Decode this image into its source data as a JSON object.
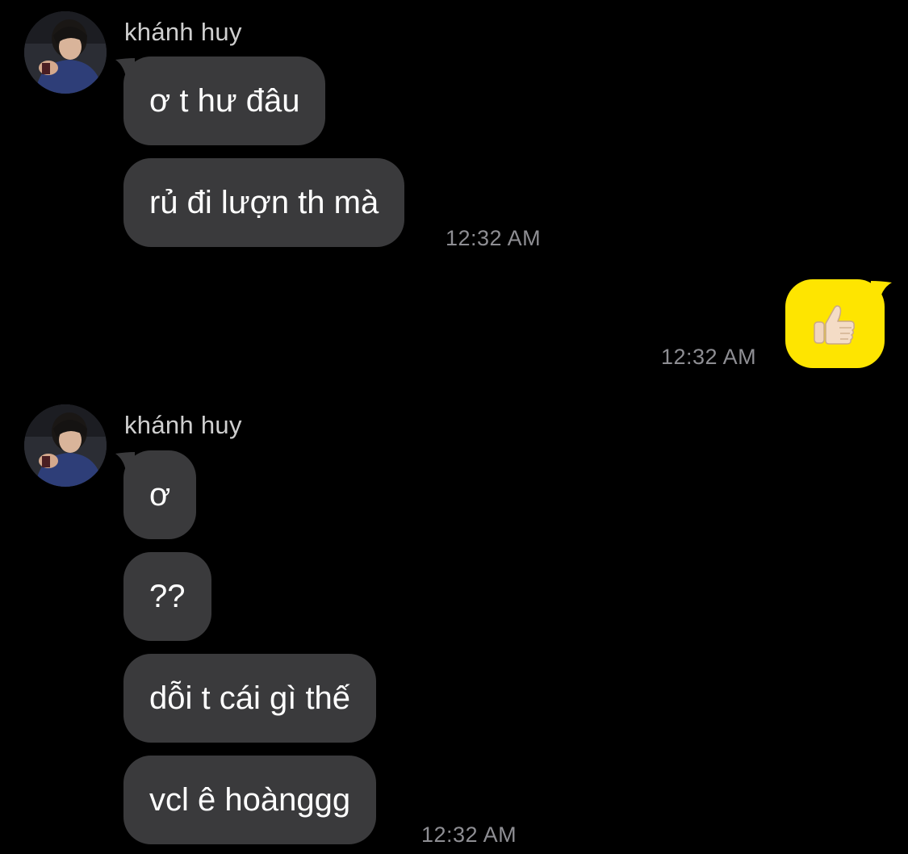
{
  "conversation": {
    "group1": {
      "sender_name": "khánh huy",
      "messages": [
        "ơ t hư đâu",
        "rủ đi lượn th mà"
      ],
      "timestamp": "12:32 AM"
    },
    "outgoing": {
      "reaction": "thumbs-up",
      "timestamp": "12:32 AM"
    },
    "group2": {
      "sender_name": "khánh huy",
      "messages": [
        "ơ",
        "??",
        "dỗi t cái gì thế",
        "vcl ê hoànggg"
      ],
      "timestamp": "12:32 AM"
    }
  },
  "colors": {
    "background": "#000000",
    "incoming_bubble": "#3a3a3c",
    "outgoing_bubble": "#fee500",
    "timestamp_text": "#8e8e93",
    "sender_name_text": "#cfcfcf"
  },
  "icons": [
    "avatar-photo",
    "thumbs-up-icon"
  ]
}
